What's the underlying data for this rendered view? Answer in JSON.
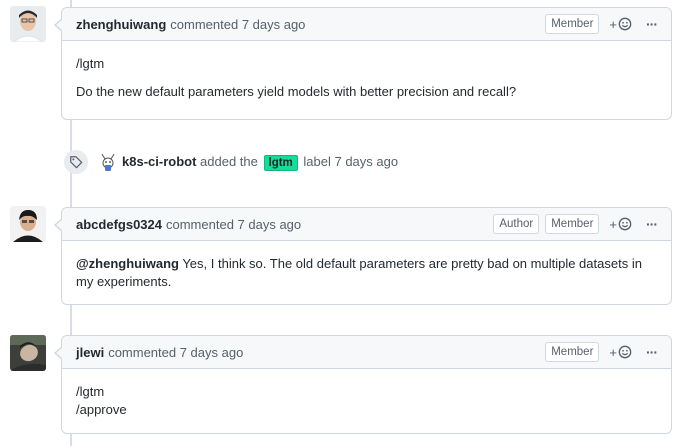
{
  "comments": [
    {
      "author": "zhenghuiwang",
      "meta": "commented 7 days ago",
      "badges": [
        "Member"
      ],
      "lines": [
        "/lgtm",
        "Do the new default parameters yield models with better precision and recall?"
      ]
    },
    {
      "author": "abcdefgs0324",
      "meta": "commented 7 days ago",
      "badges": [
        "Author",
        "Member"
      ],
      "mention": "@zhenghuiwang",
      "body_rest": " Yes, I think so. The old default parameters are pretty bad on multiple datasets in my experiments."
    },
    {
      "author": "jlewi",
      "meta": "commented 7 days ago",
      "badges": [
        "Member"
      ],
      "lines": [
        "/lgtm",
        "/approve"
      ]
    }
  ],
  "event": {
    "author": "k8s-ci-robot",
    "action": "added the",
    "label": "lgtm",
    "label_color": "#15dc96",
    "suffix": "label 7 days ago",
    "icon": "tag-icon"
  },
  "icons": {
    "reaction": "smiley-icon",
    "more": "kebab-icon"
  },
  "reaction_plus": "+",
  "kebab_glyph": "···"
}
